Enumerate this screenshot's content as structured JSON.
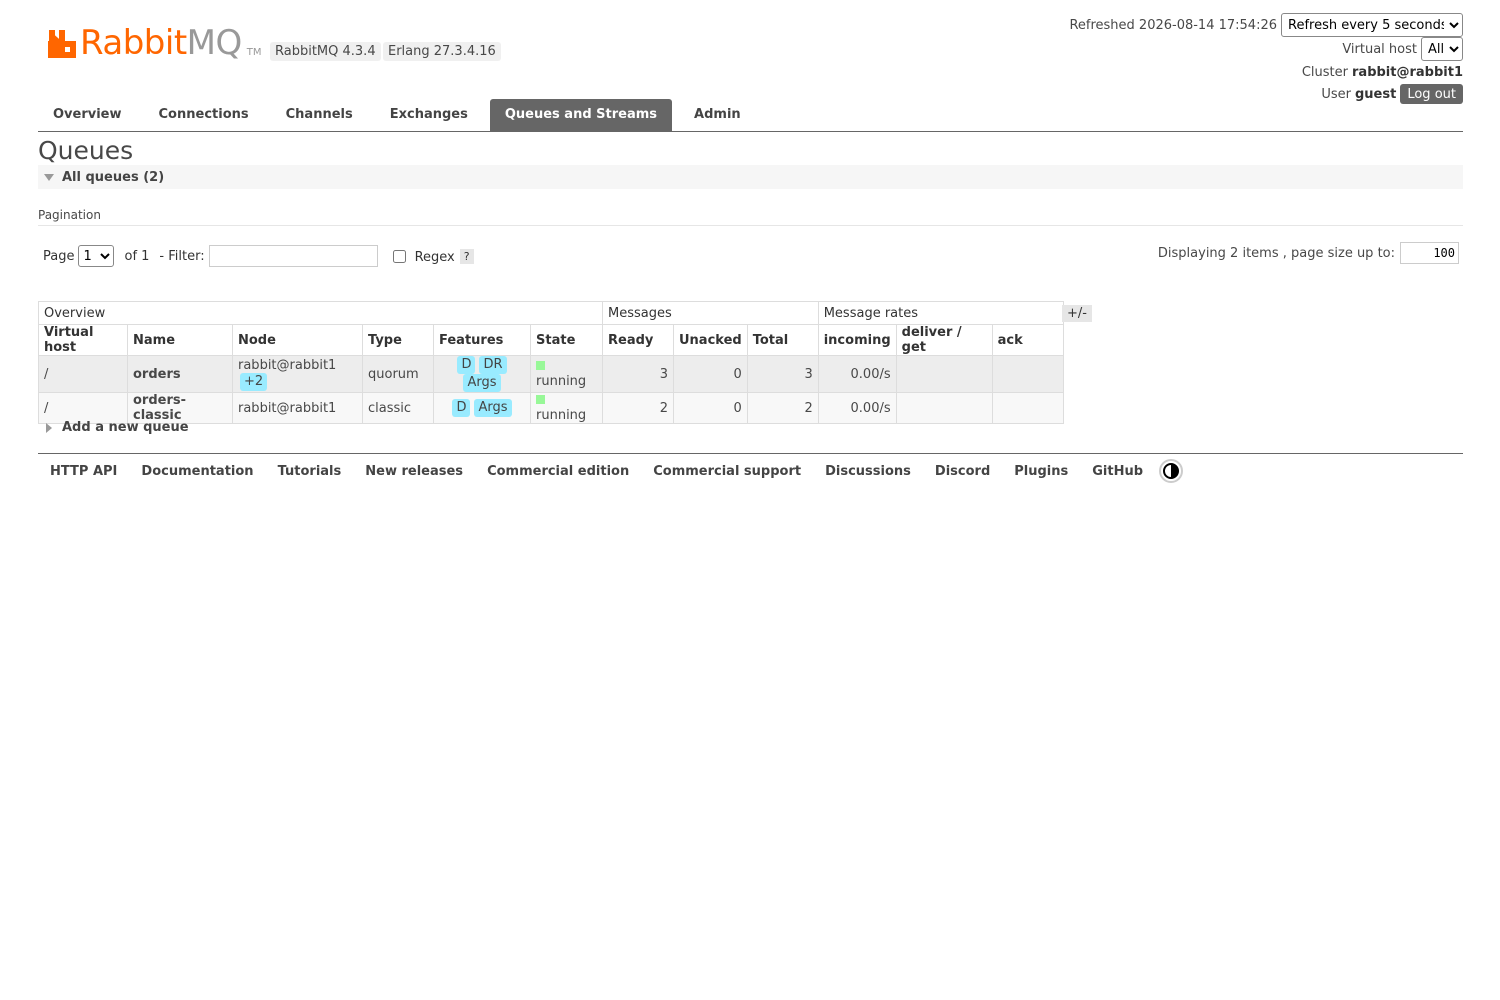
{
  "header": {
    "logo_rabbit": "Rabbit",
    "logo_mq": "MQ",
    "logo_tm": "TM",
    "rabbitmq_version": "RabbitMQ 4.3.4",
    "erlang_version": "Erlang 27.3.4.16",
    "refreshed_label": "Refreshed 2026-08-14 17:54:26",
    "refresh_select": "Refresh every 5 seconds",
    "vhost_label": "Virtual host",
    "vhost_select": "All",
    "cluster_label": "Cluster",
    "cluster_name": "rabbit@rabbit1",
    "user_label": "User",
    "user_name": "guest",
    "logout_label": "Log out"
  },
  "tabs": [
    {
      "label": "Overview"
    },
    {
      "label": "Connections"
    },
    {
      "label": "Channels"
    },
    {
      "label": "Exchanges"
    },
    {
      "label": "Queues and Streams",
      "active": true
    },
    {
      "label": "Admin"
    }
  ],
  "page": {
    "title": "Queues",
    "section_label": "All queues (2)",
    "pagination_label": "Pagination",
    "page_label": "Page",
    "page_select": "1",
    "of_label": "of 1",
    "filter_label": "- Filter:",
    "filter_value": "",
    "regex_label": "Regex",
    "help_label": "?",
    "display_label": "Displaying 2 items , page size up to:",
    "page_size": "100",
    "plus_minus": "+/-",
    "add_queue_label": "Add a new queue"
  },
  "table": {
    "groups": [
      "Overview",
      "Messages",
      "Message rates"
    ],
    "columns": [
      "Virtual host",
      "Name",
      "Node",
      "Type",
      "Features",
      "State",
      "Ready",
      "Unacked",
      "Total",
      "incoming",
      "deliver / get",
      "ack"
    ],
    "rows": [
      {
        "vhost": "/",
        "name": "orders",
        "node": "rabbit@rabbit1",
        "node_extra": "+2",
        "type": "quorum",
        "features": [
          "D",
          "DR",
          "Args"
        ],
        "state": "running",
        "ready": "3",
        "unacked": "0",
        "total": "3",
        "incoming": "0.00/s",
        "deliver_get": "",
        "ack": ""
      },
      {
        "vhost": "/",
        "name": "orders-classic",
        "node": "rabbit@rabbit1",
        "node_extra": "",
        "type": "classic",
        "features": [
          "D",
          "Args"
        ],
        "state": "running",
        "ready": "2",
        "unacked": "0",
        "total": "2",
        "incoming": "0.00/s",
        "deliver_get": "",
        "ack": ""
      }
    ]
  },
  "footer": {
    "links": [
      "HTTP API",
      "Documentation",
      "Tutorials",
      "New releases",
      "Commercial edition",
      "Commercial support",
      "Discussions",
      "Discord",
      "Plugins",
      "GitHub"
    ]
  },
  "colors": {
    "brand_orange": "#ff6600",
    "tab_active": "#666666",
    "feature_pill": "#99ebff",
    "running_state": "#98f898"
  },
  "icons": [
    "rabbitmq-logo-icon",
    "collapse-triangle-icon",
    "expand-triangle-icon",
    "running-state-icon",
    "theme-toggle-icon"
  ]
}
